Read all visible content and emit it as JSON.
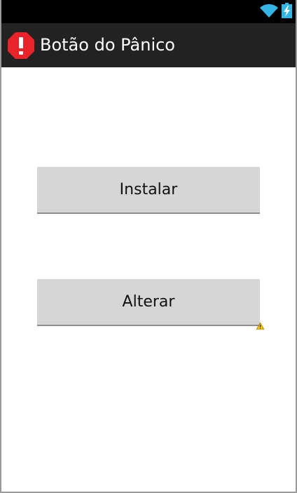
{
  "status_bar": {
    "wifi_icon": "wifi-icon",
    "battery_icon": "battery-charging-icon"
  },
  "action_bar": {
    "icon": "alert-octagon-icon",
    "title": "Botão do Pânico"
  },
  "buttons": {
    "install_label": "Instalar",
    "change_label": "Alterar"
  },
  "indicators": {
    "warning_icon": "warning-triangle-icon"
  },
  "colors": {
    "status_bar_bg": "#000000",
    "action_bar_bg": "#222222",
    "accent_blue": "#33b5e5",
    "alert_red": "#e8232a",
    "button_bg": "#d6d6d6",
    "warning_yellow": "#f2c200"
  }
}
